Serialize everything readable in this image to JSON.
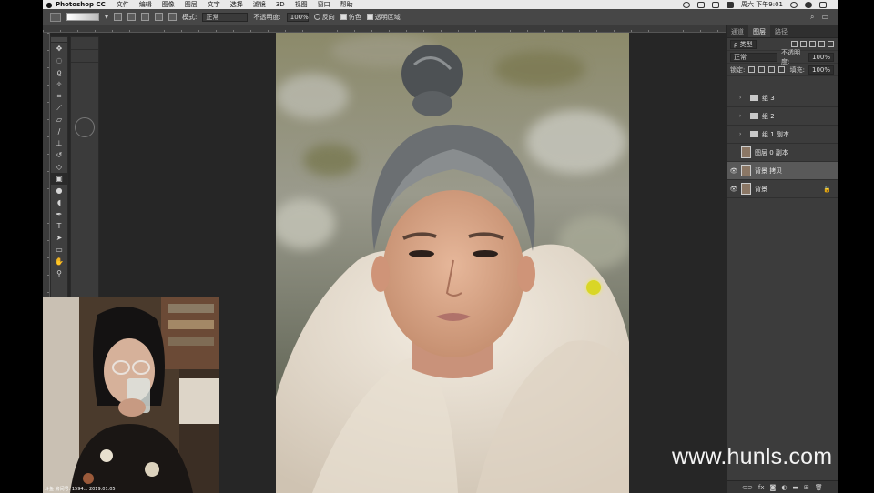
{
  "menubar": {
    "app_name": "Photoshop CC",
    "items": [
      "文件",
      "编辑",
      "图像",
      "图层",
      "文字",
      "选择",
      "滤镜",
      "3D",
      "视图",
      "窗口",
      "帮助"
    ],
    "clock": "周六 下午9:01"
  },
  "options": {
    "mode_label": "模式:",
    "mode_value": "正常",
    "opacity_label": "不透明度:",
    "opacity_value": "100%",
    "reverse_label": "反向",
    "dither_label": "仿色",
    "transparency_label": "透明区域"
  },
  "panel": {
    "tabs": [
      "通道",
      "图层",
      "路径"
    ],
    "filter_label": "ρ 类型",
    "blend_mode": "正常",
    "opacity_label": "不透明度:",
    "opacity_value": "100%",
    "lock_label": "锁定:",
    "fill_label": "填充:",
    "fill_value": "100%",
    "layers": [
      {
        "name": "组 3"
      },
      {
        "name": "组 2"
      },
      {
        "name": "组 1 副本"
      },
      {
        "name": "图层 0 副本"
      },
      {
        "name": "背景 拷贝"
      },
      {
        "name": "背景"
      }
    ],
    "bottom_fx": "fx"
  },
  "webcam": {
    "stamp": "斗鱼 房间号: 1594... 2019.01.05"
  },
  "watermark": "www.hunls.com"
}
